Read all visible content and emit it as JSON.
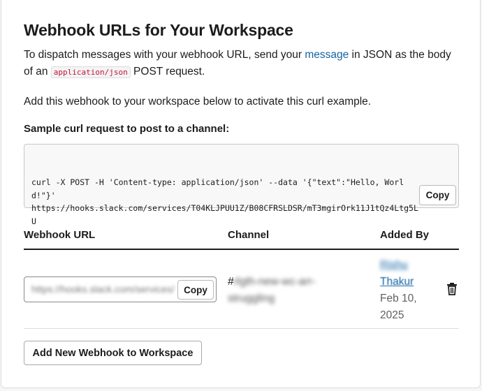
{
  "page": {
    "title": "Webhook URLs for Your Workspace",
    "intro_before_link": "To dispatch messages with your webhook URL, send your ",
    "intro_link": "message",
    "intro_after_link": " in JSON as the body of an ",
    "intro_code": "application/json",
    "intro_end": " POST request.",
    "activate_text": "Add this webhook to your workspace below to activate this curl example."
  },
  "sample": {
    "label": "Sample curl request to post to a channel:",
    "code": "curl -X POST -H 'Content-type: application/json' --data '{\"text\":\"Hello, World!\"}'\nhttps://hooks.slack.com/services/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",
    "copy_label": "Copy"
  },
  "table": {
    "headers": {
      "webhook_url": "Webhook URL",
      "channel": "Channel",
      "added_by": "Added By"
    },
    "row": {
      "url": "https://hooks.slack.com/services/",
      "copy_label": "Copy",
      "channel_hash": "#",
      "channel_name": "rlgth-new-wc-arr-struggling",
      "user_first": "Rishu",
      "user_last": "Thakur",
      "added_date": "Feb 10, 2025"
    }
  },
  "footer": {
    "add_button": "Add New Webhook to Workspace"
  },
  "colors": {
    "link": "#1264a3",
    "code_accent": "#c0143c",
    "text": "#1d1c1d"
  },
  "icons": {
    "delete": "trash-icon"
  }
}
